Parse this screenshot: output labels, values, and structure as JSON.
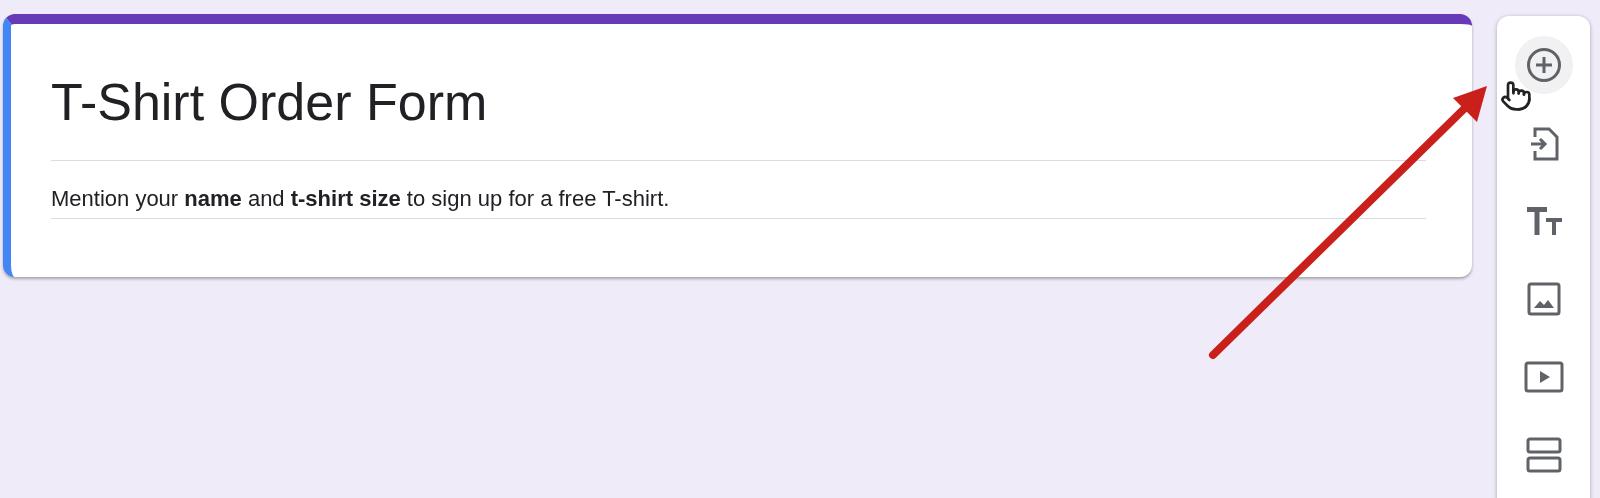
{
  "form_header": {
    "title": "T-Shirt Order Form",
    "description": "Mention your **name** and **t-shirt size** to sign up for a free T-shirt."
  },
  "toolbar": [
    {
      "kind": "add-question",
      "hovered": true
    },
    {
      "kind": "import-questions",
      "hovered": false
    },
    {
      "kind": "title",
      "hovered": false
    },
    {
      "kind": "image",
      "hovered": false
    },
    {
      "kind": "video",
      "hovered": false
    },
    {
      "kind": "section",
      "hovered": false
    }
  ]
}
